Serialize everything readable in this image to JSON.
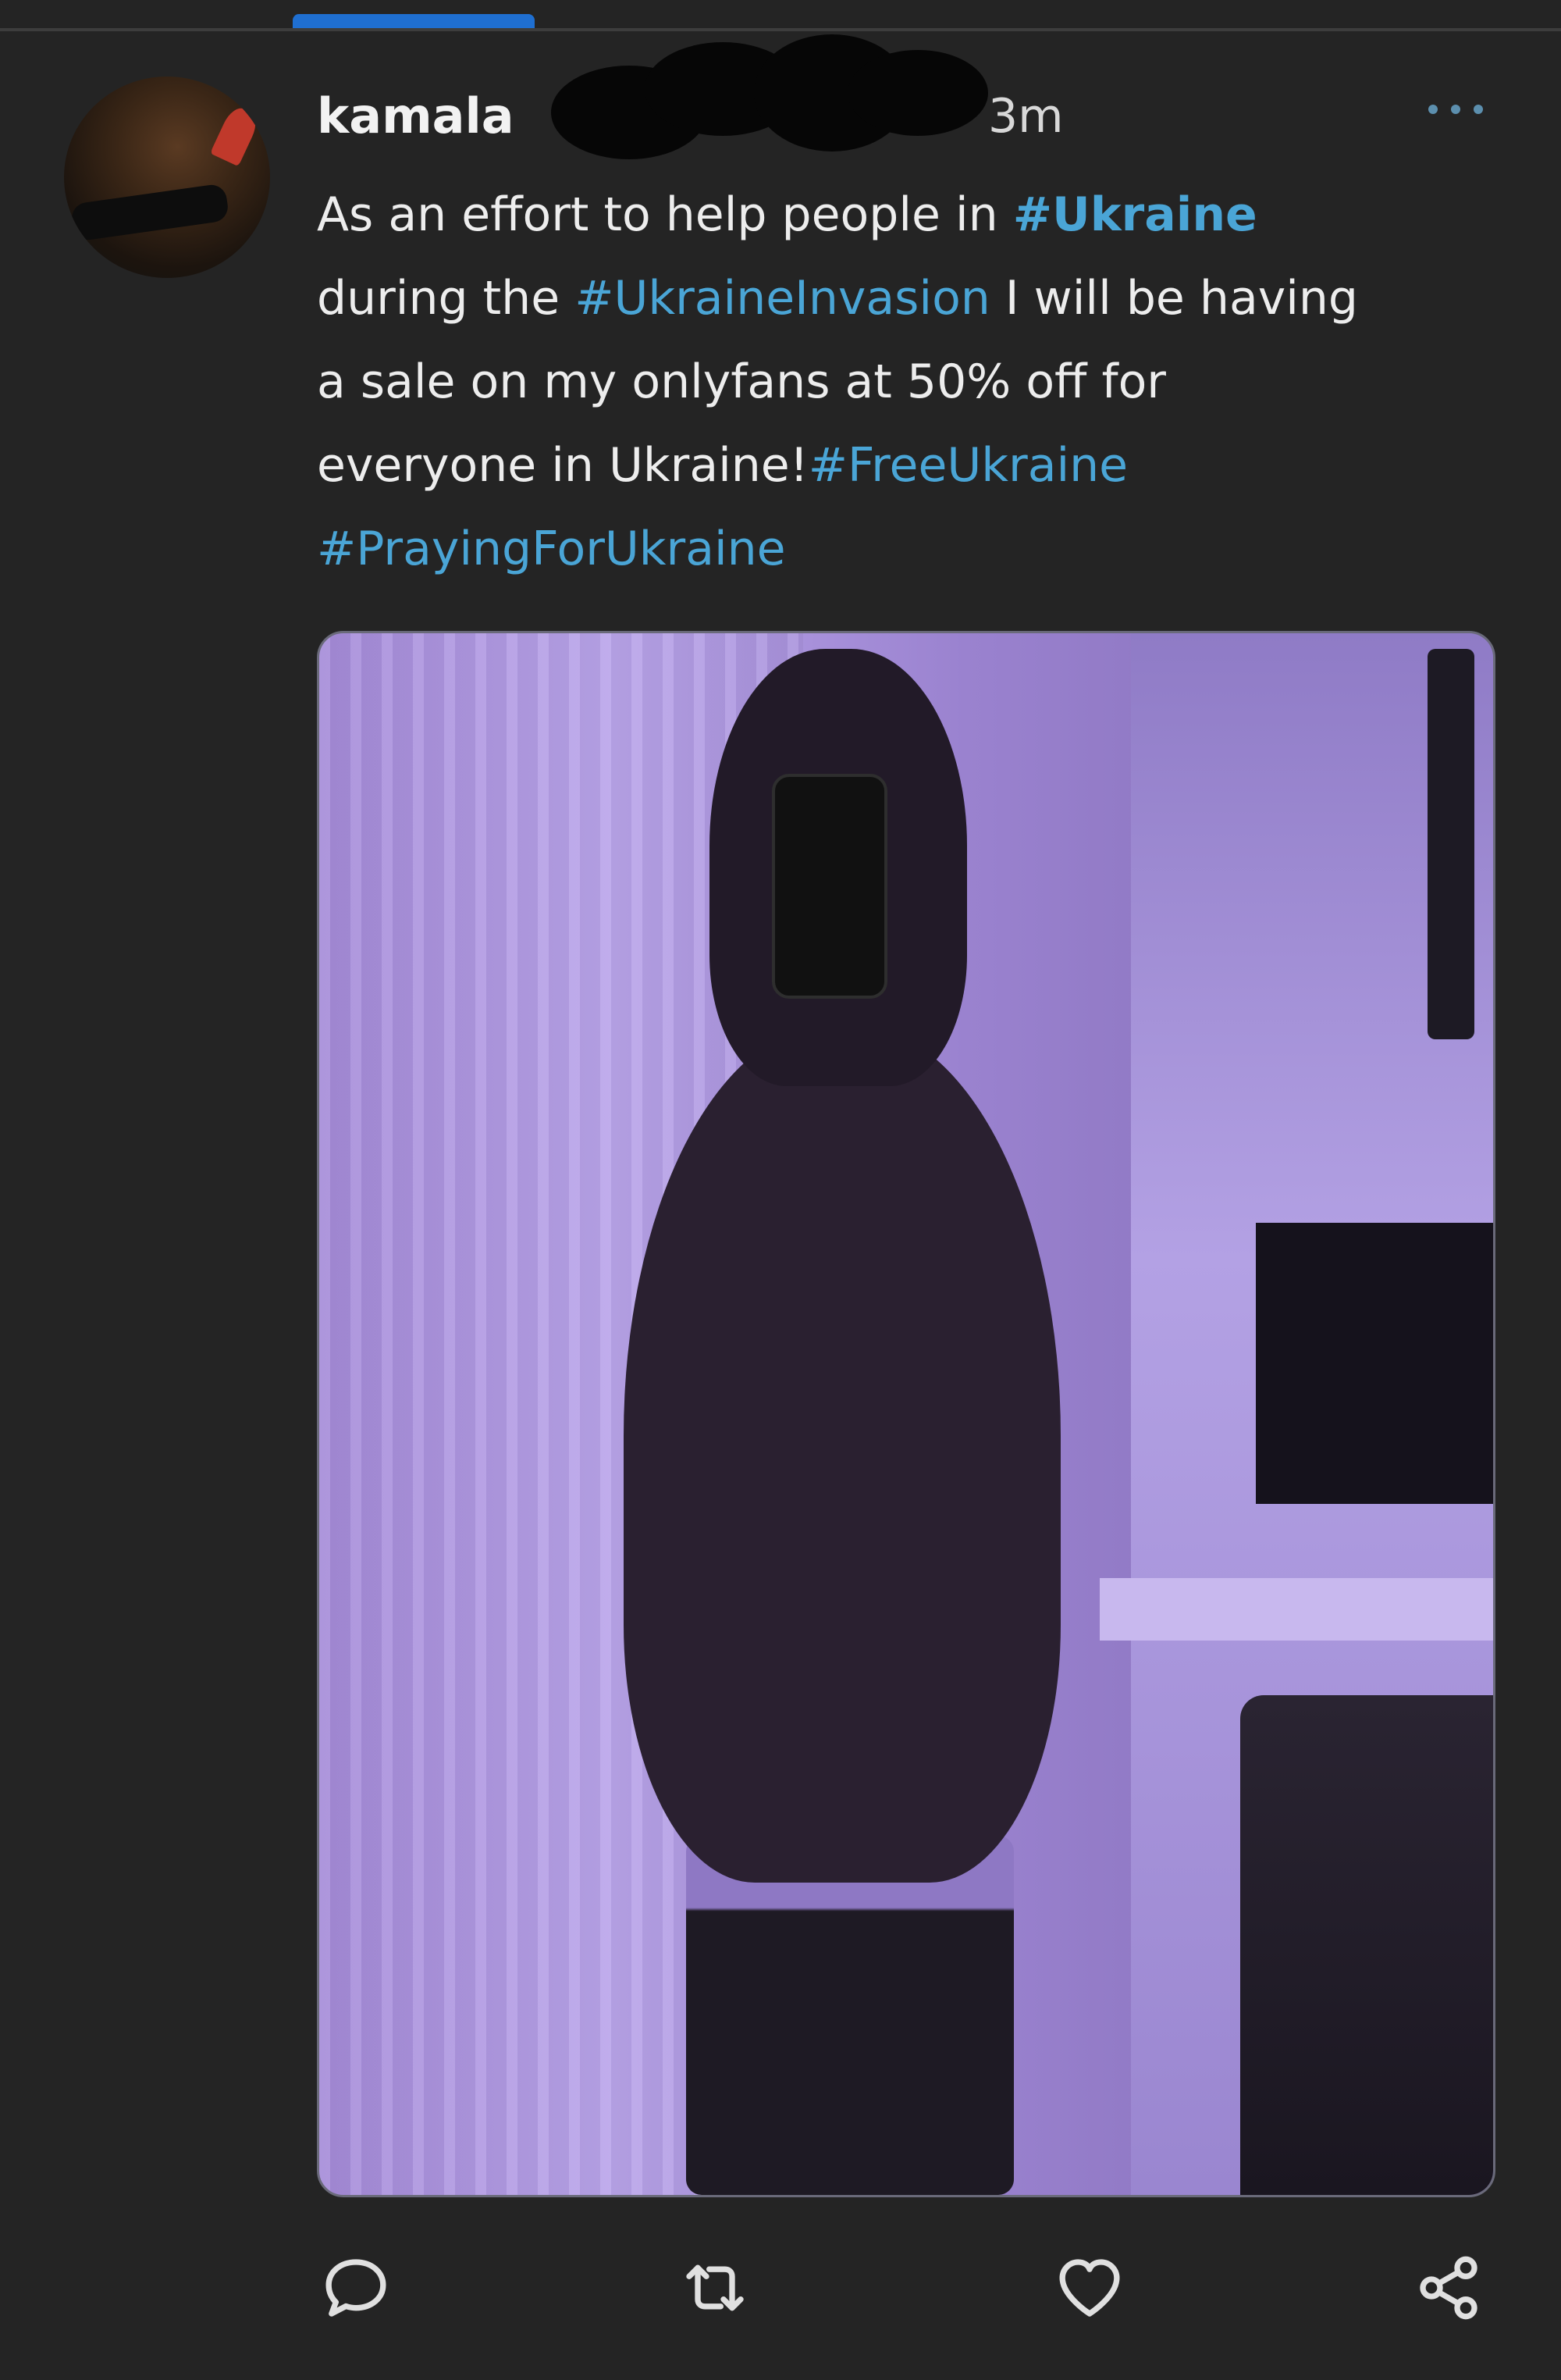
{
  "tweet": {
    "author_name": "kamala",
    "timestamp": "3m",
    "text_segments": [
      {
        "text": "As an effort to help people in ",
        "type": "plain"
      },
      {
        "text": "#Ukraine",
        "type": "hashtag-bold"
      },
      {
        "text": "\nduring the ",
        "type": "plain"
      },
      {
        "text": "#UkraineInvasion",
        "type": "hashtag"
      },
      {
        "text": " I will be having\na sale on my onlyfans at 50% off for\neveryone in Ukraine!",
        "type": "plain"
      },
      {
        "text": "#FreeUkraine",
        "type": "hashtag"
      },
      {
        "text": "\n",
        "type": "plain"
      },
      {
        "text": "#PrayingForUkraine",
        "type": "hashtag"
      }
    ]
  },
  "icons": {
    "more": "more-icon",
    "reply": "reply-icon",
    "retweet": "retweet-icon",
    "like": "like-icon",
    "share": "share-icon"
  },
  "colors": {
    "background": "#242424",
    "hashtag": "#4aa5d6",
    "text": "#ededed",
    "tab_accent": "#1f6fd1"
  }
}
